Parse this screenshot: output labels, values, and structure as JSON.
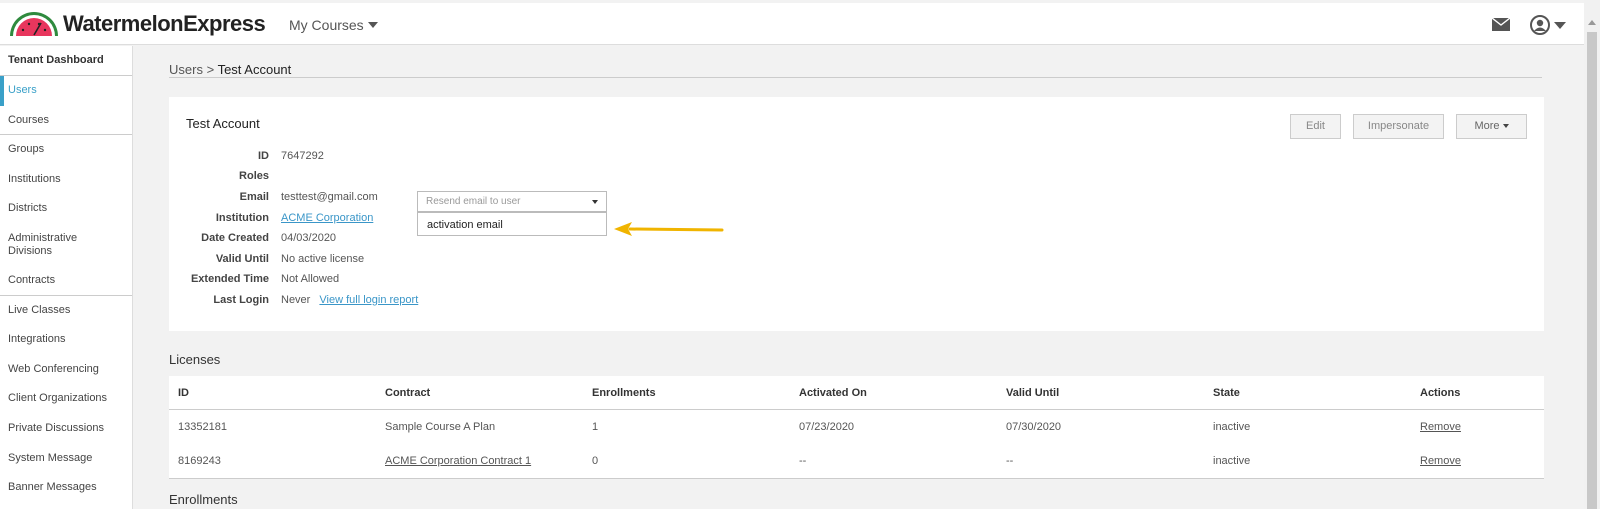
{
  "header": {
    "brand": "WatermelonExpress",
    "my_courses": "My Courses"
  },
  "sidebar": {
    "title": "Tenant Dashboard",
    "items": [
      {
        "label": "Users"
      },
      {
        "label": "Courses"
      },
      {
        "label": "Groups"
      },
      {
        "label": "Institutions"
      },
      {
        "label": "Districts"
      },
      {
        "label": "Administrative Divisions"
      },
      {
        "label": "Contracts"
      },
      {
        "label": "Live Classes"
      },
      {
        "label": "Integrations"
      },
      {
        "label": "Web Conferencing"
      },
      {
        "label": "Client Organizations"
      },
      {
        "label": "Private Discussions"
      },
      {
        "label": "System Message"
      },
      {
        "label": "Banner Messages"
      }
    ]
  },
  "breadcrumb": {
    "parent": "Users",
    "separator": ">",
    "current": "Test Account"
  },
  "profile": {
    "title": "Test Account",
    "buttons": {
      "edit": "Edit",
      "impersonate": "Impersonate",
      "more": "More"
    },
    "fields": {
      "id_label": "ID",
      "id_value": "7647292",
      "roles_label": "Roles",
      "email_label": "Email",
      "email_value": "testtest@gmail.com",
      "institution_label": "Institution",
      "institution_value": "ACME Corporation",
      "date_created_label": "Date Created",
      "date_created_value": "04/03/2020",
      "valid_until_label": "Valid Until",
      "valid_until_value": "No active license",
      "extended_time_label": "Extended Time",
      "extended_time_value": "Not Allowed",
      "last_login_label": "Last Login",
      "last_login_value": "Never",
      "login_report_link": "View full login report"
    },
    "resend": {
      "placeholder": "Resend email to user",
      "option": "activation email"
    }
  },
  "licenses": {
    "title": "Licenses",
    "headers": [
      "ID",
      "Contract",
      "Enrollments",
      "Activated On",
      "Valid Until",
      "State",
      "Actions"
    ],
    "rows": [
      {
        "id": "13352181",
        "contract": "Sample Course A Plan",
        "enrollments": "1",
        "activated_on": "07/23/2020",
        "valid_until": "07/30/2020",
        "state": "inactive",
        "action": "Remove"
      },
      {
        "id": "8169243",
        "contract": "ACME Corporation Contract 1",
        "enrollments": "0",
        "activated_on": "--",
        "valid_until": "--",
        "state": "inactive",
        "action": "Remove"
      }
    ]
  },
  "enrollments": {
    "title": "Enrollments"
  },
  "colors": {
    "accent": "#3aa0c8",
    "link": "#3a96c8",
    "remove": "#d9534f",
    "arrow": "#f0b400"
  }
}
